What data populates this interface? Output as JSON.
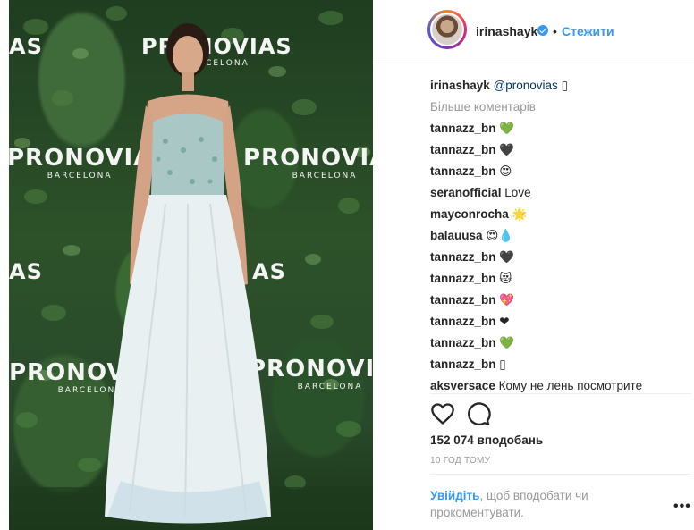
{
  "photo": {
    "brand_name": "PRONOVIAS",
    "brand_sub": "BARCELONA",
    "brand_partial_left": "AS",
    "brand_partial_right": "PRONOVIA",
    "brand_partial_mid": "AS"
  },
  "header": {
    "username": "irinashayk",
    "separator": "•",
    "follow_label": "Стежити"
  },
  "caption": {
    "user": "irinashayk",
    "mention": "@pronovias",
    "emoji": "▯"
  },
  "more_comments": "Більше коментарів",
  "comments": [
    {
      "user": "tannazz_bn",
      "text": "💚"
    },
    {
      "user": "tannazz_bn",
      "text": "🖤"
    },
    {
      "user": "tannazz_bn",
      "text": "😍"
    },
    {
      "user": "seranofficial",
      "text": "Love"
    },
    {
      "user": "mayconrocha",
      "text": "🌟"
    },
    {
      "user": "balauusa",
      "text": "😍💧"
    },
    {
      "user": "tannazz_bn",
      "text": "🖤"
    },
    {
      "user": "tannazz_bn",
      "text": "😻"
    },
    {
      "user": "tannazz_bn",
      "text": "💖"
    },
    {
      "user": "tannazz_bn",
      "text": "❤"
    },
    {
      "user": "tannazz_bn",
      "text": "💚"
    },
    {
      "user": "tannazz_bn",
      "text": "▯"
    },
    {
      "user": "aksversace",
      "text": "Кому не лень посмотрите"
    }
  ],
  "likes": "152 074 вподобань",
  "time_ago": "10 ГОД ТОМУ",
  "login_prompt": {
    "link": "Увійдіть",
    "text": ", щоб вподобати чи прокоментувати."
  },
  "more_options": "•••",
  "colors": {
    "link_blue": "#3897f0",
    "verified_blue": "#3897f0",
    "muted": "#999999",
    "text": "#262626"
  },
  "icons": [
    "heart-icon",
    "comment-icon",
    "verified-badge-icon"
  ]
}
